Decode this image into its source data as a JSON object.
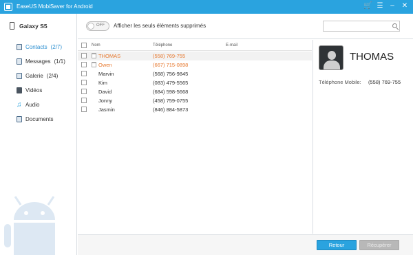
{
  "window": {
    "title": "EaseUS MobiSaver for Android"
  },
  "sidebar": {
    "device_name": "Galaxy S5",
    "items": [
      {
        "label": "Contacts",
        "count": "(2/7)",
        "active": true,
        "icon": "contacts-icon"
      },
      {
        "label": "Messages",
        "count": "(1/1)",
        "active": false,
        "icon": "messages-icon"
      },
      {
        "label": "Galerie",
        "count": "(2/4)",
        "active": false,
        "icon": "gallery-icon"
      },
      {
        "label": "Vidéos",
        "count": "",
        "active": false,
        "icon": "video-icon"
      },
      {
        "label": "Audio",
        "count": "",
        "active": false,
        "icon": "audio-icon"
      },
      {
        "label": "Documents",
        "count": "",
        "active": false,
        "icon": "documents-icon"
      }
    ]
  },
  "toolbar": {
    "toggle_state": "OFF",
    "toggle_label": "Afficher les seuls éléments supprimés",
    "search_placeholder": ""
  },
  "table": {
    "headers": {
      "name": "Nom",
      "phone": "Téléphone",
      "email": "E-mail"
    },
    "rows": [
      {
        "name": "THOMAS",
        "phone": "(558) 769-755",
        "deleted": true,
        "selected": true
      },
      {
        "name": "Owen",
        "phone": "(667) 715-0898",
        "deleted": true,
        "selected": false
      },
      {
        "name": "Marvin",
        "phone": "(568) 756-9845",
        "deleted": false,
        "selected": false
      },
      {
        "name": "Kim",
        "phone": "(083) 479-5565",
        "deleted": false,
        "selected": false
      },
      {
        "name": "David",
        "phone": "(684) 598-5668",
        "deleted": false,
        "selected": false
      },
      {
        "name": "Jonny",
        "phone": "(458) 759-0755",
        "deleted": false,
        "selected": false
      },
      {
        "name": "Jasmin",
        "phone": "(846) 884-5873",
        "deleted": false,
        "selected": false
      }
    ]
  },
  "detail": {
    "name": "THOMAS",
    "phone_label": "Téléphone Mobile:",
    "phone_value": "(558) 769-755"
  },
  "footer": {
    "back_label": "Retour",
    "recover_label": "Récupérer"
  },
  "colors": {
    "accent": "#2aa3df",
    "deleted": "#e6762b"
  }
}
